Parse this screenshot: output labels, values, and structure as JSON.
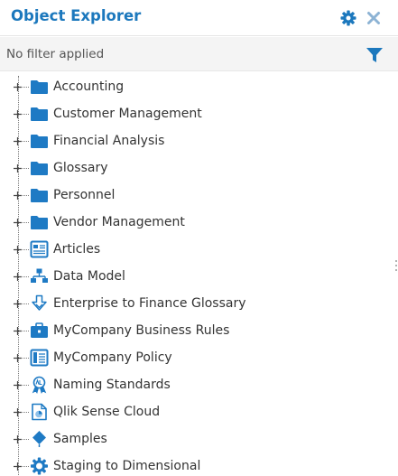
{
  "header": {
    "title": "Object Explorer",
    "settings_icon": "gear-icon",
    "close_icon": "close-icon"
  },
  "filter": {
    "status": "No filter applied",
    "icon": "funnel-icon"
  },
  "colors": {
    "accent": "#1c78bd",
    "folder": "#1e7ac4",
    "text": "#333333"
  },
  "tree": {
    "items": [
      {
        "label": "Accounting",
        "icon": "folder-icon"
      },
      {
        "label": "Customer Management",
        "icon": "folder-icon"
      },
      {
        "label": "Financial Analysis",
        "icon": "folder-icon"
      },
      {
        "label": "Glossary",
        "icon": "folder-icon"
      },
      {
        "label": "Personnel",
        "icon": "folder-icon"
      },
      {
        "label": "Vendor Management",
        "icon": "folder-icon"
      },
      {
        "label": "Articles",
        "icon": "articles-icon"
      },
      {
        "label": "Data Model",
        "icon": "data-model-icon"
      },
      {
        "label": "Enterprise to Finance Glossary",
        "icon": "mapping-icon"
      },
      {
        "label": "MyCompany Business Rules",
        "icon": "briefcase-icon"
      },
      {
        "label": "MyCompany Policy",
        "icon": "policy-icon"
      },
      {
        "label": "Naming Standards",
        "icon": "naming-standards-icon"
      },
      {
        "label": "Qlik Sense Cloud",
        "icon": "qlik-report-icon"
      },
      {
        "label": "Samples",
        "icon": "samples-icon"
      },
      {
        "label": "Staging to Dimensional",
        "icon": "staging-gear-icon"
      }
    ]
  }
}
